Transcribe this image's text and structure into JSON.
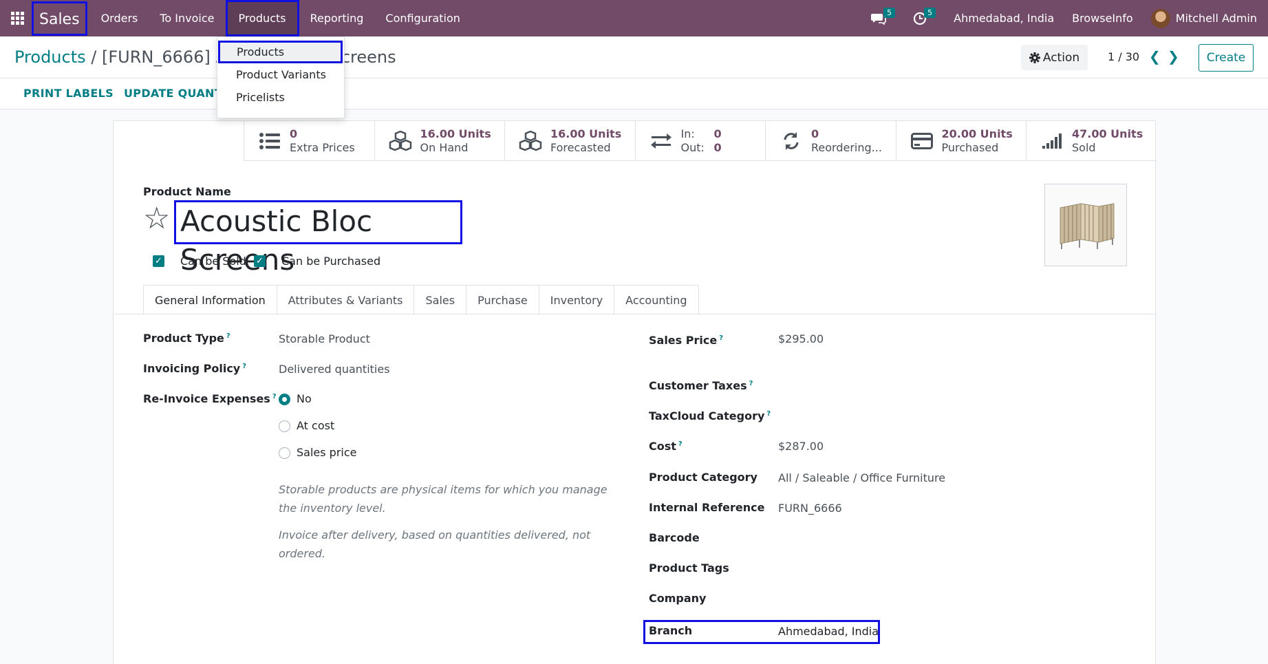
{
  "navbar": {
    "app_name": "Sales",
    "menu": [
      "Orders",
      "To Invoice",
      "Products",
      "Reporting",
      "Configuration"
    ],
    "messages_count": "5",
    "activities_count": "5",
    "branch": "Ahmedabad, India",
    "company": "BrowseInfo",
    "user": "Mitchell Admin"
  },
  "dropdown": {
    "items": [
      "Products",
      "Product Variants",
      "Pricelists"
    ]
  },
  "control_panel": {
    "breadcrumb_root": "Products",
    "separator": "/",
    "breadcrumb_current": "[FURN_6666] Acoustic Bloc Screens",
    "action_label": "Action",
    "pager": "1 / 30",
    "create_label": "Create"
  },
  "statusbar": {
    "print_labels": "PRINT LABELS",
    "update_quantity": "UPDATE QUANTITY"
  },
  "stats": [
    {
      "icon": "list-icon",
      "value": "0",
      "label": "Extra Prices"
    },
    {
      "icon": "cubes-icon",
      "value": "16.00 Units",
      "label": "On Hand"
    },
    {
      "icon": "cubes-icon",
      "value": "16.00 Units",
      "label": "Forecasted"
    },
    {
      "icon": "exchange-icon",
      "in_label": "In:",
      "in_value": "0",
      "out_label": "Out:",
      "out_value": "0"
    },
    {
      "icon": "refresh-icon",
      "value": "0",
      "label": "Reordering..."
    },
    {
      "icon": "credit-card-icon",
      "value": "20.00 Units",
      "label": "Purchased"
    },
    {
      "icon": "signal-icon",
      "value": "47.00 Units",
      "label": "Sold"
    }
  ],
  "product": {
    "name_label": "Product Name",
    "name": "Acoustic Bloc Screens",
    "can_be_sold": "Can be Sold",
    "can_be_purchased": "Can be Purchased"
  },
  "tabs": [
    "General Information",
    "Attributes & Variants",
    "Sales",
    "Purchase",
    "Inventory",
    "Accounting"
  ],
  "general": {
    "product_type_label": "Product Type",
    "product_type": "Storable Product",
    "invoicing_policy_label": "Invoicing Policy",
    "invoicing_policy": "Delivered quantities",
    "reinvoice_label": "Re-Invoice Expenses",
    "reinvoice_options": [
      "No",
      "At cost",
      "Sales price"
    ],
    "help_storable": "Storable products are physical items for which you manage the inventory level.",
    "help_invoice": "Invoice after delivery, based on quantities delivered, not ordered.",
    "sales_price_label": "Sales Price",
    "sales_price": "$295.00",
    "customer_taxes_label": "Customer Taxes",
    "taxcloud_label": "TaxCloud Category",
    "cost_label": "Cost",
    "cost": "$287.00",
    "category_label": "Product Category",
    "category": "All / Saleable / Office Furniture",
    "internal_ref_label": "Internal Reference",
    "internal_ref": "FURN_6666",
    "barcode_label": "Barcode",
    "tags_label": "Product Tags",
    "company_label": "Company",
    "branch_label": "Branch",
    "branch": "Ahmedabad, India"
  },
  "help_marker": "?",
  "colors": {
    "navbar": "#714b67",
    "accent": "#017e84",
    "highlight": "#1010e0"
  }
}
